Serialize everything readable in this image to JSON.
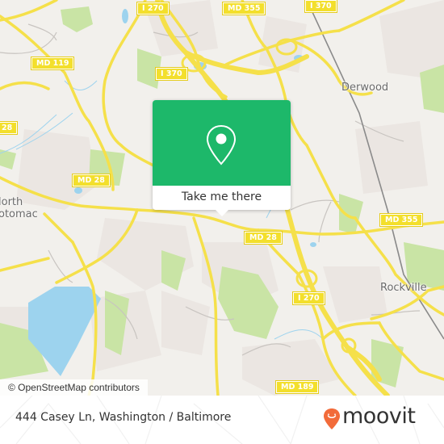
{
  "map": {
    "colors": {
      "land": "#f2f0ec",
      "residential": "#ebe6e2",
      "park": "#c9e4a5",
      "water": "#9dd3ee",
      "road_major": "#f5e04a",
      "road_minor": "#c8c4c0",
      "rail": "#8a8a8a"
    },
    "road_shields": [
      {
        "id": "i270-top",
        "label": "I 270"
      },
      {
        "id": "md355-top",
        "label": "MD 355"
      },
      {
        "id": "i370-topright",
        "label": "I 370"
      },
      {
        "id": "md119",
        "label": "MD 119"
      },
      {
        "id": "i370-mid",
        "label": "I 370"
      },
      {
        "id": "md28-left",
        "label": "28"
      },
      {
        "id": "md28-center",
        "label": "MD 28"
      },
      {
        "id": "md28-right",
        "label": "MD 28"
      },
      {
        "id": "md355-right",
        "label": "MD 355"
      },
      {
        "id": "i270-bottom",
        "label": "I 270"
      },
      {
        "id": "md189",
        "label": "MD 189"
      }
    ],
    "places": [
      {
        "id": "derwood",
        "label": "Derwood"
      },
      {
        "id": "north-potomac",
        "label": "North\nPotomac"
      },
      {
        "id": "north-potomac-line1",
        "label": "lorth"
      },
      {
        "id": "north-potomac-line2",
        "label": "otomac"
      },
      {
        "id": "rockville",
        "label": "Rockville"
      }
    ],
    "attribution": "© OpenStreetMap contributors",
    "popup": {
      "icon": "location-pin-icon",
      "button_label": "Take me there",
      "color": "#1db86a"
    }
  },
  "footer": {
    "address": "444 Casey Ln, Washington / Baltimore",
    "brand": "moovit",
    "brand_color": "#f26b3a"
  }
}
